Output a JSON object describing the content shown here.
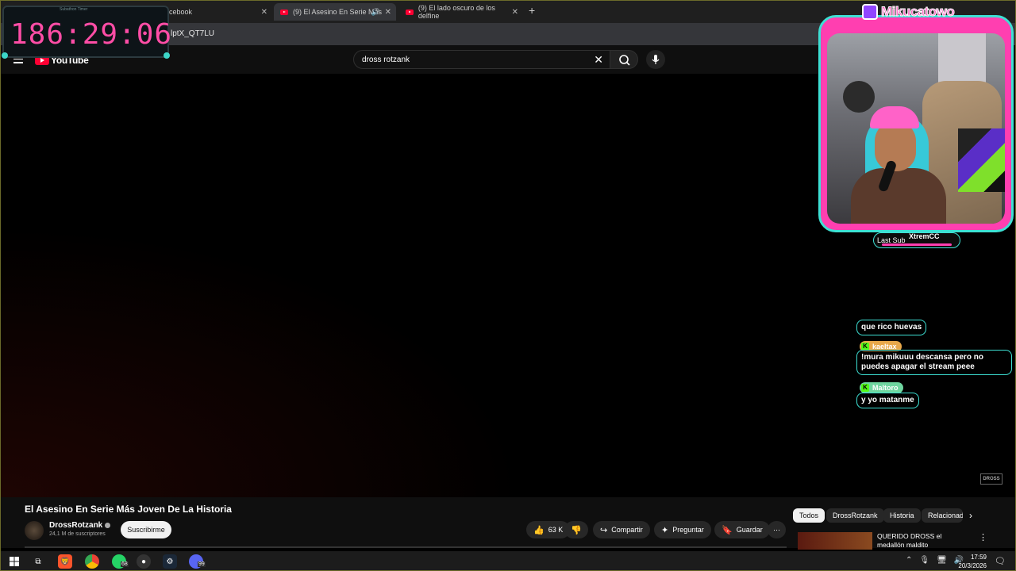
{
  "browser": {
    "tabs": [
      {
        "title": "cebook",
        "active": false
      },
      {
        "title": "(9) El Asesino En Serie Más",
        "active": true
      },
      {
        "title": "(9) El lado oscuro de los delfine",
        "active": false
      }
    ],
    "new_tab_label": "+",
    "url_fragment": "lptX_QT7LU"
  },
  "stream_overlay": {
    "timer": "186:29:06",
    "timer_caption": "Subathon Timer",
    "streamer_name": "Mikucatowo",
    "last_sub_label": "Last Sub",
    "last_sub_name": "XtremCC",
    "chat": [
      {
        "user": "",
        "text": "que rico huevas"
      },
      {
        "user": "kaeltax",
        "text": "!mura mikuuu descansa pero no puedes apagar el stream peee"
      },
      {
        "user": "Maltoro",
        "text": "y yo matanme"
      }
    ],
    "kick_badge": "K",
    "colors": {
      "accent_pink": "#ff3fb0",
      "accent_cyan": "#3de0d4",
      "timer_pink": "#ff4da6"
    }
  },
  "youtube": {
    "logo_text": "YouTube",
    "search_query": "dross rotzank",
    "video_title": "El Asesino En Serie Más Joven De La Historia",
    "channel_name": "DrossRotzank",
    "subscribers": "24,1 M de suscriptores",
    "subscribe_label": "Suscribirme",
    "like_count": "63 K",
    "share_label": "Compartir",
    "ask_label": "Preguntar",
    "save_label": "Guardar",
    "more_label": "⋯",
    "chips": [
      "Todos",
      "DrossRotzank",
      "Historia",
      "Relacionad"
    ],
    "recommended_title": "QUERIDO DROSS el medallón maldito",
    "watermark": "DROSS"
  },
  "taskbar": {
    "whatsapp_badge": "68",
    "discord_badge": "99",
    "time": "17:59",
    "date": "20/3/2026"
  }
}
